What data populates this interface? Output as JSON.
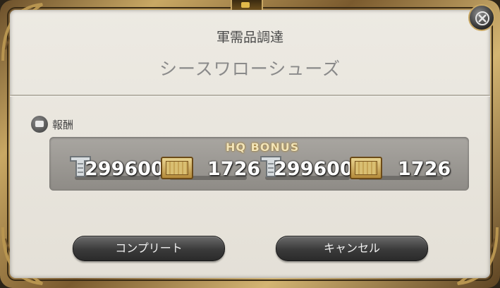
{
  "window": {
    "title": "軍需品調達",
    "subtitle": "シースワローシューズ"
  },
  "reward": {
    "label": "報酬",
    "hq_label": "HQ BONUS",
    "items": [
      {
        "icon": "exp-icon",
        "value": "2996000"
      },
      {
        "icon": "seal-icon",
        "value": "1726"
      },
      {
        "icon": "exp-icon",
        "value": "2996000"
      },
      {
        "icon": "seal-icon",
        "value": "1726"
      }
    ]
  },
  "buttons": {
    "complete": "コンプリート",
    "cancel": "キャンセル"
  },
  "colors": {
    "frame_gold": "#c9a864",
    "panel_bg": "#e8e5de",
    "reward_box": "#9d9a95",
    "hq_label": "#f2e4b8"
  }
}
